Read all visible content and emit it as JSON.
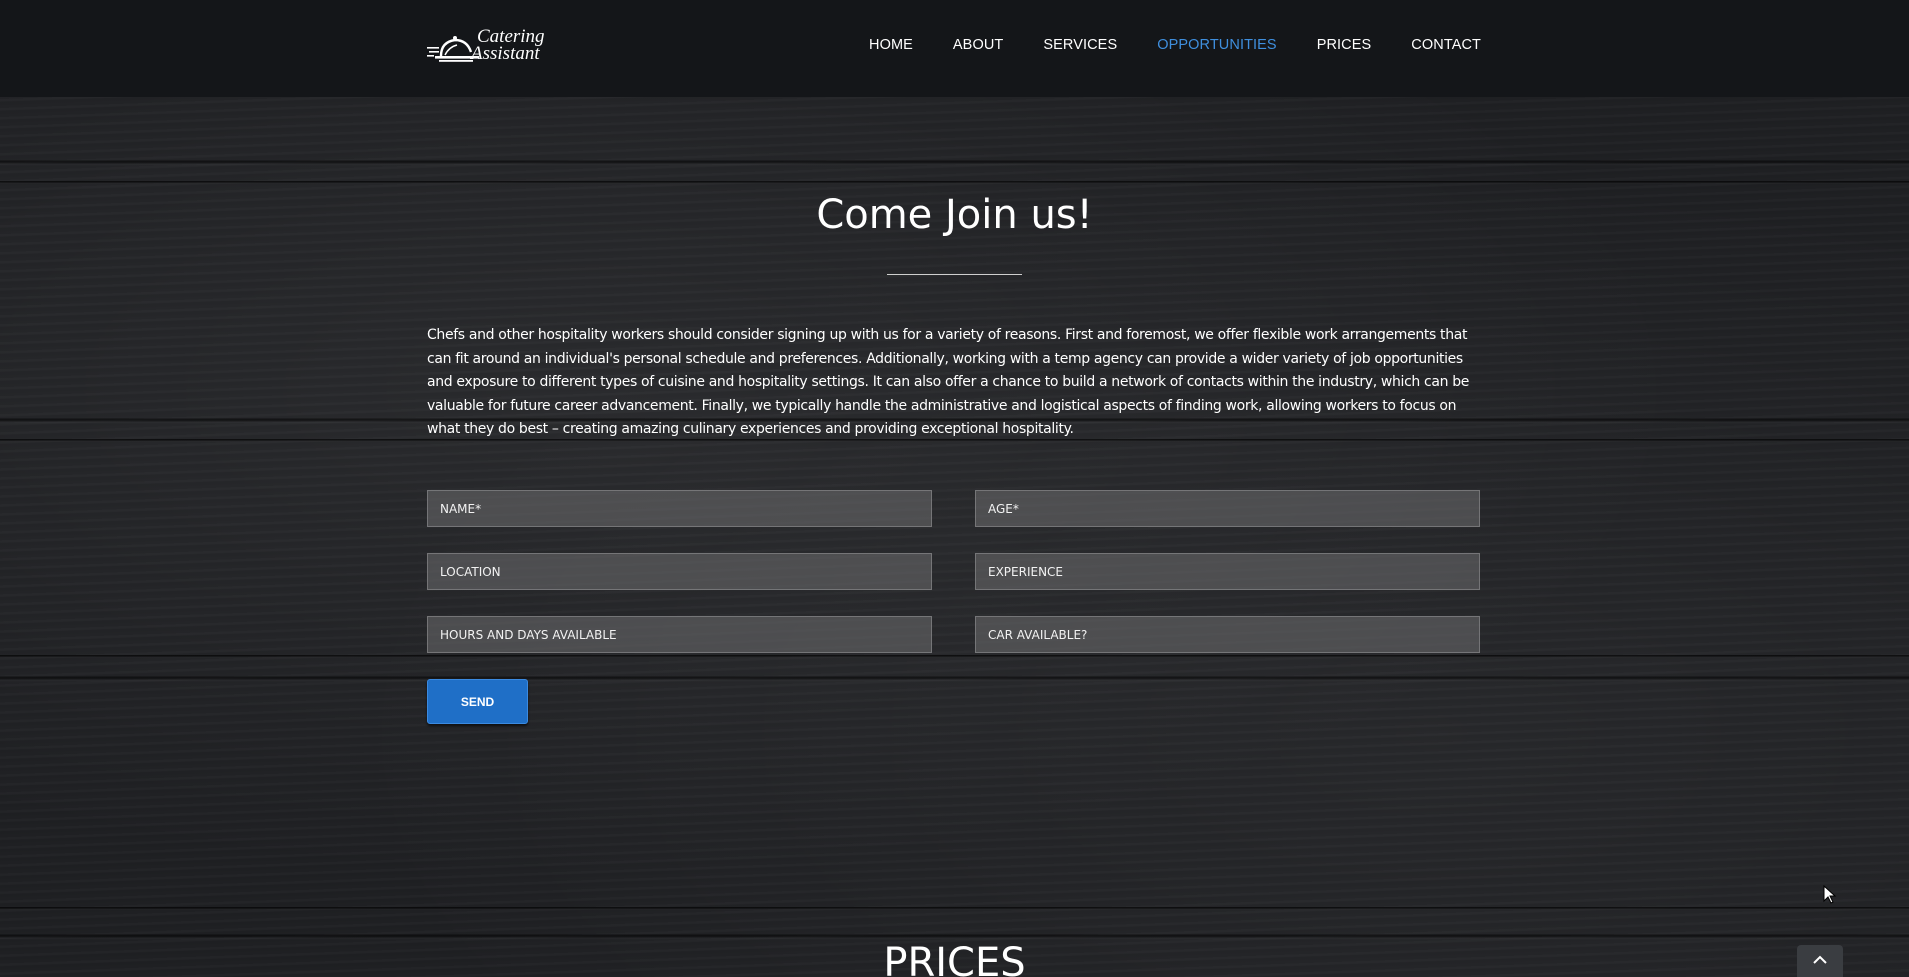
{
  "brand": {
    "logo_line1": "Catering",
    "logo_line2": "Assistant"
  },
  "nav": {
    "items": [
      {
        "label": "HOME"
      },
      {
        "label": "ABOUT"
      },
      {
        "label": "SERVICES"
      },
      {
        "label": "OPPORTUNITIES"
      },
      {
        "label": "PRICES"
      },
      {
        "label": "CONTACT"
      }
    ],
    "active_item": "OPPORTUNITIES",
    "active_color": "#3f8fde"
  },
  "join_section": {
    "title": "Come Join us!",
    "intro": "Chefs and other hospitality workers should consider signing up with us for a variety of reasons. First and foremost, we offer flexible work arrangements that can fit around an individual's personal schedule and preferences. Additionally, working with a temp agency can provide a wider variety of job opportunities and exposure to different types of cuisine and hospitality settings. It can also offer a chance to build a network of contacts within the industry, which can be valuable for future career advancement. Finally, we typically handle the administrative and logistical aspects of finding work, allowing workers to focus on what they do best – creating amazing culinary experiences and providing exceptional hospitality."
  },
  "form": {
    "name_placeholder": "NAME*",
    "age_placeholder": "AGE*",
    "location_placeholder": "LOCATION",
    "experience_placeholder": "EXPERIENCE",
    "hours_placeholder": "HOURS AND DAYS AVAILABLE",
    "car_placeholder": "CAR AVAILABLE?",
    "send_label": "SEND",
    "button_color": "#1f6fc7"
  },
  "prices_section": {
    "title": "PRICES"
  },
  "icons": {
    "scroll_top": "chevron-up-icon",
    "logo": "cloche-icon"
  }
}
